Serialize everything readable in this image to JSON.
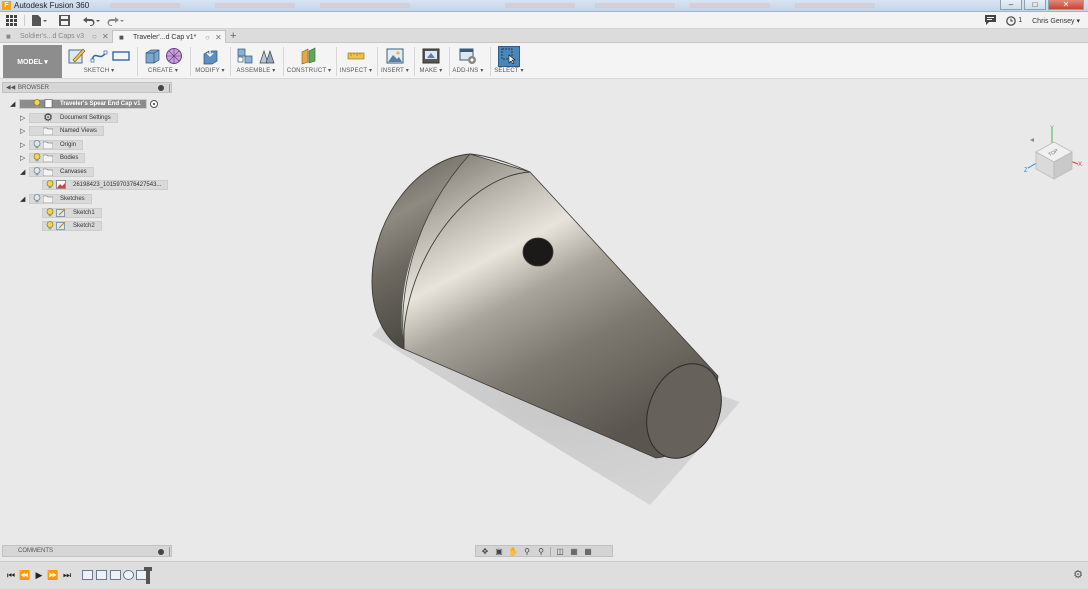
{
  "window": {
    "title": "Autodesk Fusion 360",
    "app_icon": "F",
    "controls": [
      "minimize",
      "maximize",
      "close"
    ]
  },
  "app_toolbar": {
    "icons": [
      "apps-grid-icon",
      "file-icon",
      "save-icon",
      "undo-icon",
      "redo-icon"
    ],
    "right": {
      "notifications_icon": "comment-icon",
      "job_count": "1",
      "user_name": "Chris Gensey ▾"
    }
  },
  "doc_tabs": [
    {
      "label": "Soldier's...d Caps v3",
      "active": false
    },
    {
      "label": "Traveler'...d Cap v1*",
      "active": true
    }
  ],
  "new_tab_label": "+",
  "ribbon": {
    "workspace": "MODEL ▾",
    "groups": [
      {
        "key": "sketch",
        "label": "SKETCH ▾"
      },
      {
        "key": "create",
        "label": "CREATE ▾"
      },
      {
        "key": "modify",
        "label": "MODIFY ▾"
      },
      {
        "key": "assemble",
        "label": "ASSEMBLE ▾"
      },
      {
        "key": "construct",
        "label": "CONSTRUCT ▾"
      },
      {
        "key": "inspect",
        "label": "INSPECT ▾"
      },
      {
        "key": "insert",
        "label": "INSERT ▾"
      },
      {
        "key": "make",
        "label": "MAKE ▾"
      },
      {
        "key": "addins",
        "label": "ADD-INS ▾"
      },
      {
        "key": "select",
        "label": "SELECT ▾"
      }
    ]
  },
  "browser": {
    "title": "BROWSER",
    "root": "Traveler's Spear End Cap v1",
    "nodes": [
      {
        "label": "Document Settings"
      },
      {
        "label": "Named Views"
      },
      {
        "label": "Origin"
      },
      {
        "label": "Bodies"
      },
      {
        "label": "Canvases"
      },
      {
        "label": "26198423_1015970376427543..."
      },
      {
        "label": "Sketches"
      },
      {
        "label": "Sketch1"
      },
      {
        "label": "Sketch2"
      }
    ]
  },
  "view_cube": {
    "face_label": "TOP",
    "axes": [
      "Y",
      "X",
      "Z"
    ]
  },
  "comments": {
    "title": "COMMENTS"
  },
  "colors": {
    "workspace_bg": "#8d8d8d",
    "select_blue": "#4a86b8",
    "viewport_bg": "#e9e9e9",
    "metal_dark": "#5e5a53",
    "metal_light": "#ddd9d2"
  }
}
